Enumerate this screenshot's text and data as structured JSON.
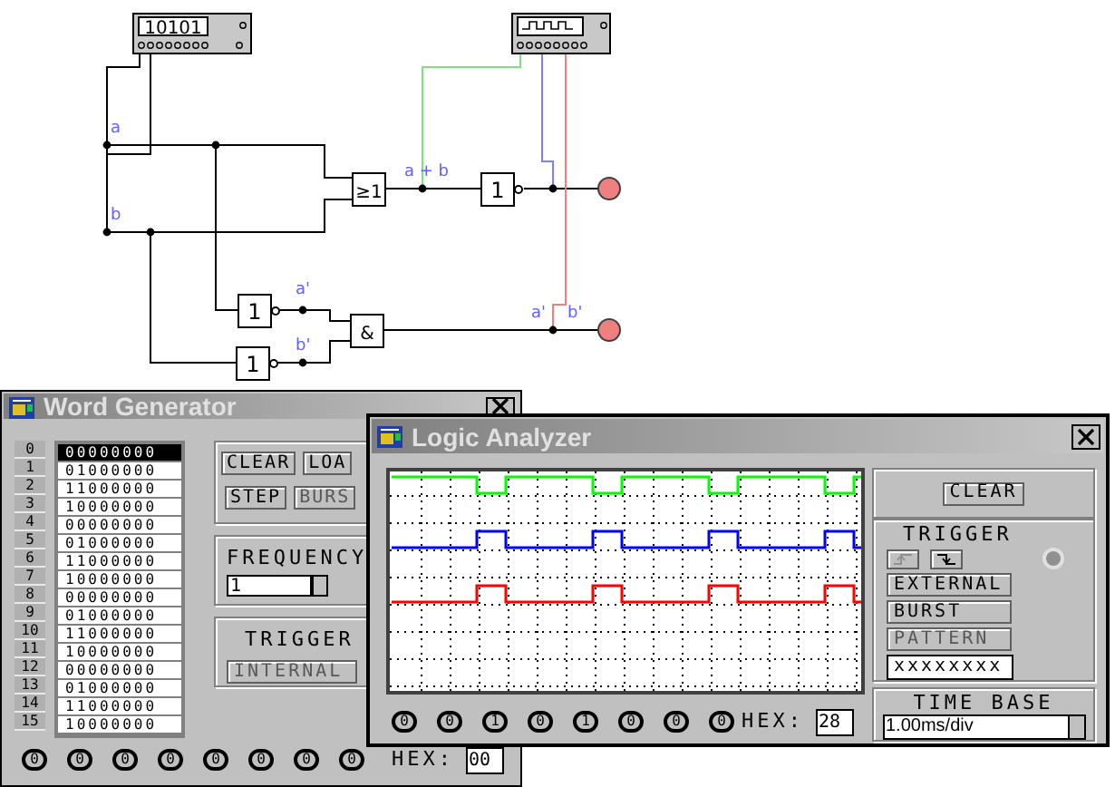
{
  "circuit": {
    "word_generator_device": {
      "display": "10101"
    },
    "wire_labels": [
      {
        "text": "a"
      },
      {
        "text": "b"
      },
      {
        "text": "a + b"
      },
      {
        "text": "a'"
      },
      {
        "text": "b'"
      },
      {
        "text": "a'"
      },
      {
        "text": "b'"
      }
    ],
    "gates": [
      {
        "kind": "or",
        "label": "≥1"
      },
      {
        "kind": "not",
        "label": "1"
      },
      {
        "kind": "not",
        "label": "1"
      },
      {
        "kind": "not",
        "label": "1"
      },
      {
        "kind": "and",
        "label": "&"
      }
    ],
    "probes": [
      {
        "on": true
      },
      {
        "on": true
      }
    ]
  },
  "word_generator": {
    "title": "Word Generator",
    "words": [
      {
        "index": "0",
        "value": "00000000",
        "selected": true
      },
      {
        "index": "1",
        "value": "01000000",
        "selected": false
      },
      {
        "index": "2",
        "value": "11000000",
        "selected": false
      },
      {
        "index": "3",
        "value": "10000000",
        "selected": false
      },
      {
        "index": "4",
        "value": "00000000",
        "selected": false
      },
      {
        "index": "5",
        "value": "01000000",
        "selected": false
      },
      {
        "index": "6",
        "value": "11000000",
        "selected": false
      },
      {
        "index": "7",
        "value": "10000000",
        "selected": false
      },
      {
        "index": "8",
        "value": "00000000",
        "selected": false
      },
      {
        "index": "9",
        "value": "01000000",
        "selected": false
      },
      {
        "index": "10",
        "value": "11000000",
        "selected": false
      },
      {
        "index": "11",
        "value": "10000000",
        "selected": false
      },
      {
        "index": "12",
        "value": "00000000",
        "selected": false
      },
      {
        "index": "13",
        "value": "01000000",
        "selected": false
      },
      {
        "index": "14",
        "value": "11000000",
        "selected": false
      },
      {
        "index": "15",
        "value": "10000000",
        "selected": false
      }
    ],
    "buttons": [
      {
        "label": "CLEAR",
        "disabled": false
      },
      {
        "label": "LOA",
        "disabled": false
      },
      {
        "label": "STEP",
        "disabled": false
      },
      {
        "label": "BURS",
        "disabled": true
      }
    ],
    "frequency": {
      "label": "FREQUENCY",
      "value": "1"
    },
    "trigger": {
      "label": "TRIGGER",
      "buttons": [
        {
          "label": "INTERNAL",
          "disabled": true
        }
      ]
    },
    "outputs": [
      "0",
      "0",
      "0",
      "0",
      "0",
      "0",
      "0",
      "0"
    ],
    "hex_label": "HEX:",
    "hex": "00"
  },
  "logic_analyzer": {
    "title": "Logic Analyzer",
    "traces": [
      {
        "color": "#00ff00",
        "idle_high": true
      },
      {
        "color": "#0000ff",
        "idle_high": false
      },
      {
        "color": "#ff0000",
        "idle_high": false
      }
    ],
    "inputs": [
      "0",
      "0",
      "1",
      "0",
      "1",
      "0",
      "0",
      "0"
    ],
    "hex_label": "HEX:",
    "hex": "28",
    "clear_button": "CLEAR",
    "trigger": {
      "label": "TRIGGER",
      "radio": {
        "disabled": true
      },
      "edge_buttons": [
        {
          "disabled": true
        },
        {
          "disabled": false
        }
      ],
      "buttons": [
        {
          "label": "EXTERNAL",
          "disabled": false
        },
        {
          "label": "BURST",
          "disabled": false
        },
        {
          "label": "PATTERN",
          "disabled": true
        }
      ],
      "pattern": "xxxxxxxx"
    },
    "time_base": {
      "label": "TIME BASE",
      "value": "1.00ms/div"
    }
  }
}
